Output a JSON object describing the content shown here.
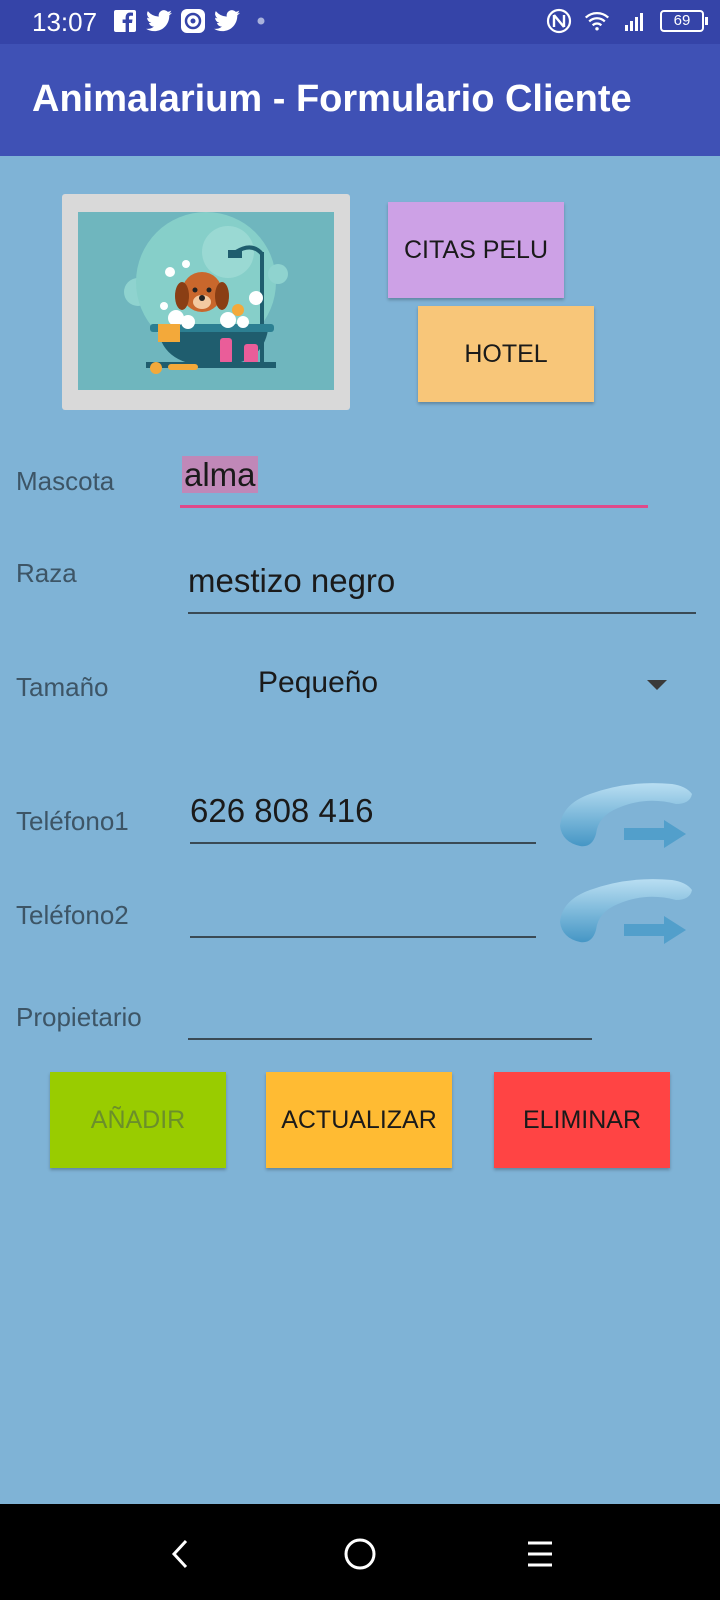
{
  "status_bar": {
    "time": "13:07",
    "battery": "69",
    "left_icons": [
      "facebook-icon",
      "twitter-icon",
      "app-icon",
      "twitter-icon",
      "dot-icon"
    ],
    "right_icons": [
      "nfc-icon",
      "wifi-icon",
      "signal-icon",
      "battery-icon"
    ]
  },
  "app_bar": {
    "title": "Animalarium - Formulario Cliente"
  },
  "top_buttons": {
    "citas": "CITAS PELU",
    "hotel": "HOTEL"
  },
  "form": {
    "mascota": {
      "label": "Mascota",
      "value_selected": "alma"
    },
    "raza": {
      "label": "Raza",
      "value": "mestizo negro"
    },
    "tamano": {
      "label": "Tamaño",
      "value": "Pequeño"
    },
    "telefono1": {
      "label": "Teléfono1",
      "value": "626 808 416"
    },
    "telefono2": {
      "label": "Teléfono2",
      "value": ""
    },
    "propietario": {
      "label": "Propietario",
      "value": ""
    }
  },
  "actions": {
    "add": "AÑADIR",
    "update": "ACTUALIZAR",
    "delete": "ELIMINAR"
  },
  "colors": {
    "status_bar": "#3544a8",
    "app_bar": "#3f51b5",
    "background": "#7fb3d6",
    "citas": "#cda1e6",
    "hotel": "#f8c679",
    "add": "#99cc00",
    "update": "#ffbb33",
    "delete": "#ff4444",
    "focus_underline": "#e04a8a"
  },
  "nav": {
    "icons": [
      "back-icon",
      "home-icon",
      "menu-icon"
    ]
  }
}
